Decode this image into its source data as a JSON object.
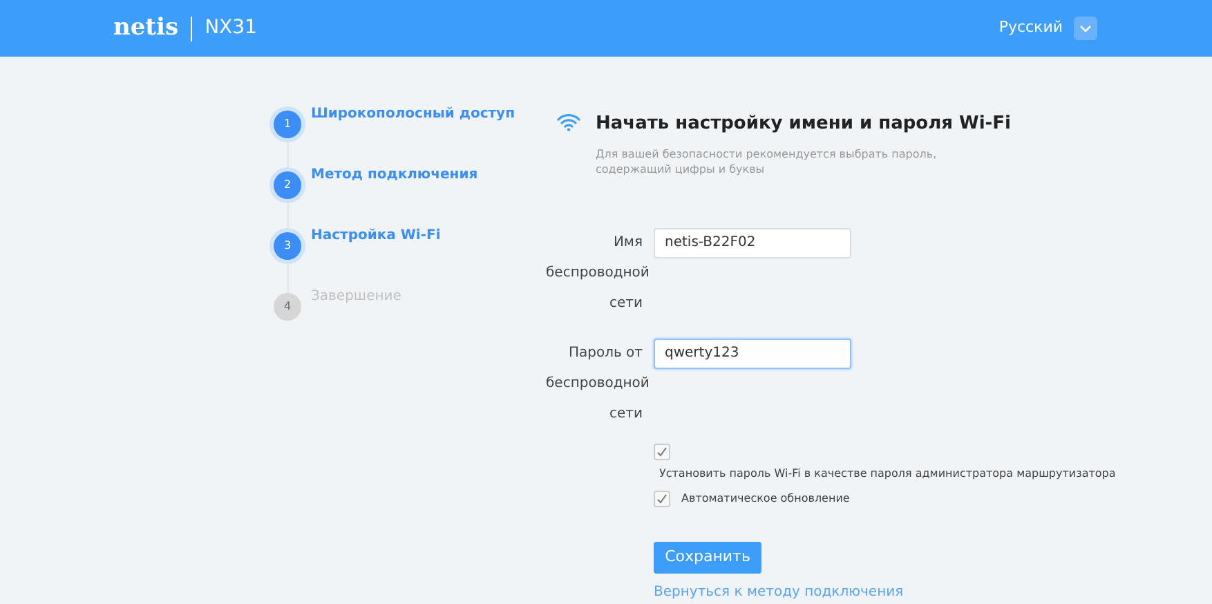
{
  "header": {
    "brand": "netis",
    "model": "NX31",
    "language": "Русский"
  },
  "steps": [
    {
      "number": "1",
      "label": "Широкополосный доступ",
      "completed": true
    },
    {
      "number": "2",
      "label": "Метод подключения",
      "completed": true
    },
    {
      "number": "3",
      "label": "Настройка Wi-Fi",
      "completed": true
    },
    {
      "number": "4",
      "label": "Завершение",
      "completed": false
    }
  ],
  "form": {
    "title": "Начать настройку имени и пароля Wi-Fi",
    "hint": "Для вашей безопасности рекомендуется выбрать пароль, содержащий цифры и буквы",
    "fields": [
      {
        "label": "Имя беспроводной сети",
        "value": "netis-B22F02",
        "focused": false
      },
      {
        "label": "Пароль от беспроводной сети",
        "value": "qwerty123",
        "focused": true
      }
    ],
    "options": [
      {
        "label": "Установить пароль Wi-Fi в качестве пароля администратора маршрутизатора",
        "checked": true,
        "kind": "below"
      },
      {
        "label": "Автоматическое обновление",
        "checked": true,
        "kind": "inline"
      }
    ],
    "save_button": "Сохранить",
    "back_link": "Вернуться к методу подключения"
  }
}
